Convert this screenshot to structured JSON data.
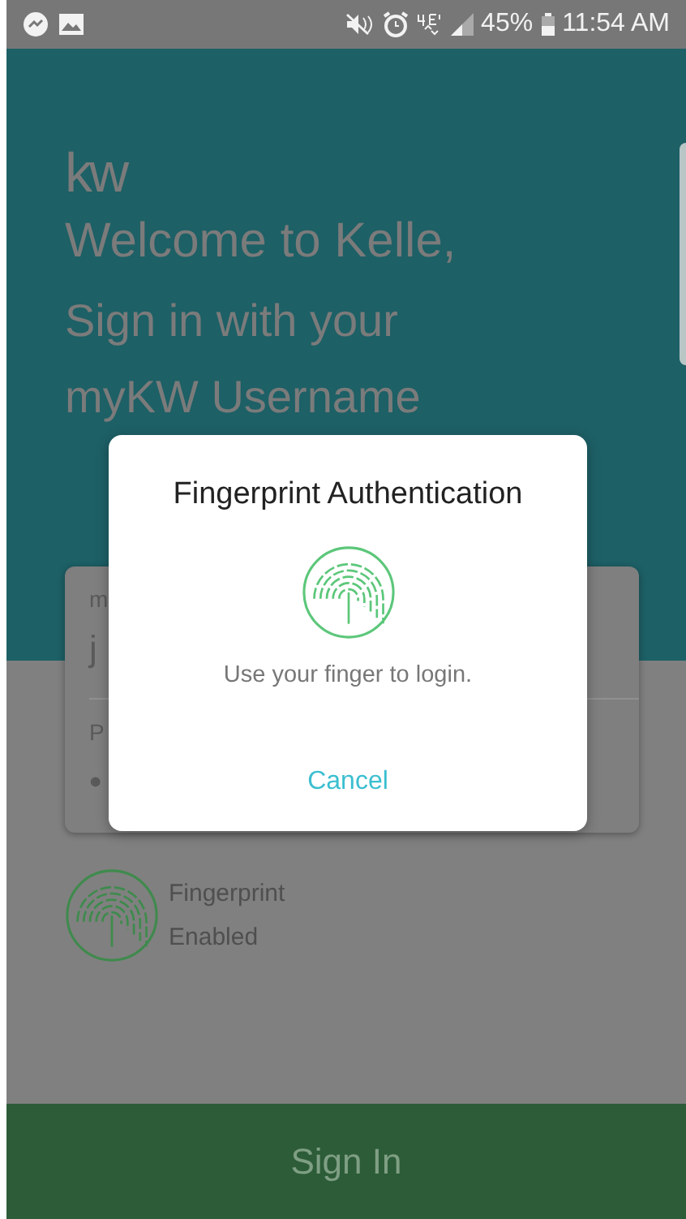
{
  "status_bar": {
    "battery": "45%",
    "time": "11:54 AM"
  },
  "header": {
    "logo": "kw",
    "title": "Welcome to Kelle,",
    "subtitle": [
      "Sign in with your",
      "myKW Username"
    ]
  },
  "login_form": {
    "fields": [
      {
        "label": "m",
        "value": "j"
      },
      {
        "label": "P",
        "value": "•"
      }
    ]
  },
  "fingerprint": {
    "lines": [
      "Fingerprint",
      "Enabled"
    ]
  },
  "sign_in_button": "Sign In",
  "dialog": {
    "title": "Fingerprint Authentication",
    "message": "Use your finger to login.",
    "button": "Cancel"
  }
}
